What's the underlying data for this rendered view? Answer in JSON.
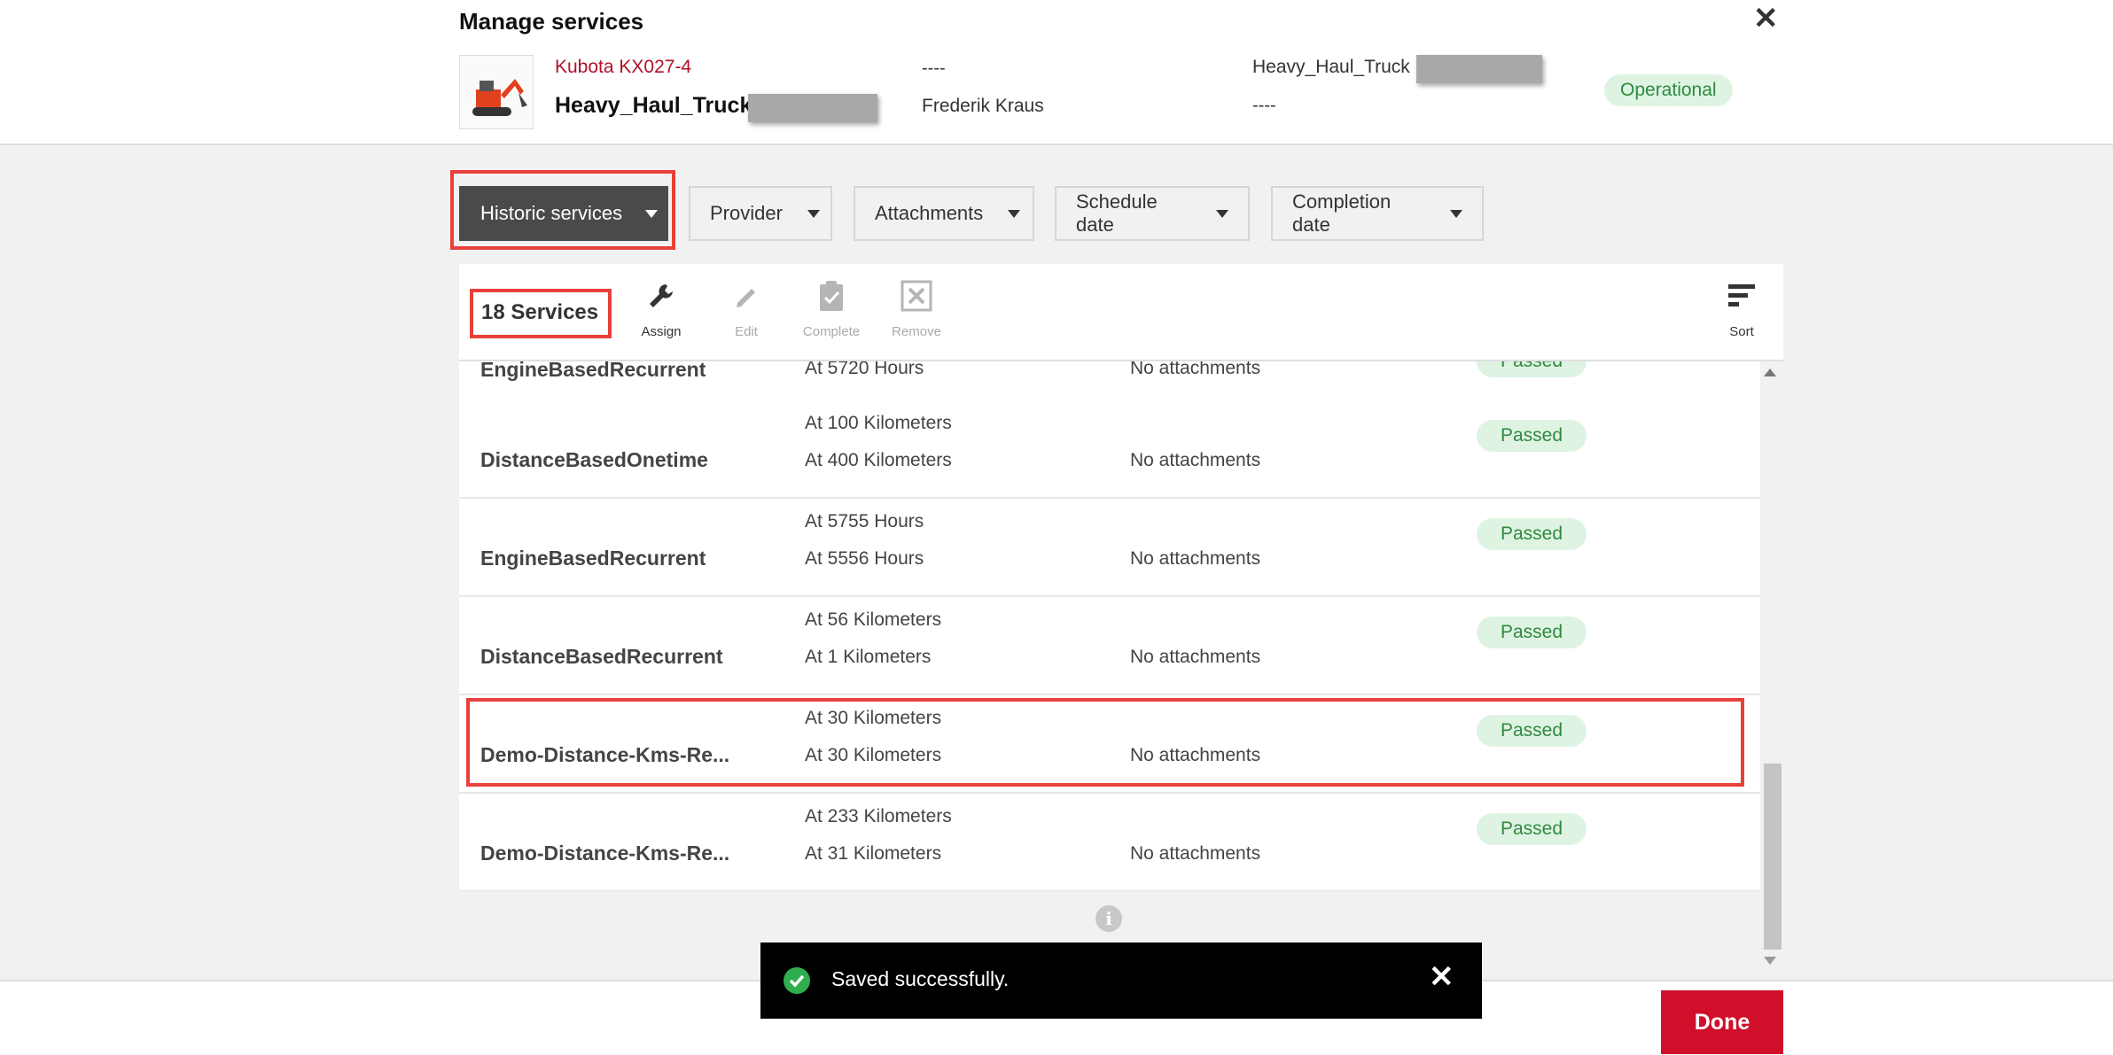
{
  "header": {
    "title": "Manage services",
    "close_icon": "close-icon",
    "asset": {
      "model": "Kubota KX027-4",
      "name": "Heavy_Haul_Truck",
      "col2_top": "----",
      "col2_bottom": "Frederik Kraus",
      "col3_top": "Heavy_Haul_Truck",
      "col3_bottom": "----",
      "status": "Operational"
    }
  },
  "filters": {
    "historic": "Historic services",
    "provider": "Provider",
    "attachments": "Attachments",
    "schedule_date": "Schedule date",
    "completion_date": "Completion date"
  },
  "toolbar": {
    "count": "18 Services",
    "assign": "Assign",
    "edit": "Edit",
    "complete": "Complete",
    "remove": "Remove",
    "sort": "Sort"
  },
  "rows": [
    {
      "name": "EngineBasedRecurrent",
      "v1": "",
      "v2": "At 5720 Hours",
      "attachments": "No attachments",
      "status": "Passed"
    },
    {
      "name": "DistanceBasedOnetime",
      "v1": "At 100 Kilometers",
      "v2": "At 400 Kilometers",
      "attachments": "No attachments",
      "status": "Passed"
    },
    {
      "name": "EngineBasedRecurrent",
      "v1": "At 5755 Hours",
      "v2": "At 5556 Hours",
      "attachments": "No attachments",
      "status": "Passed"
    },
    {
      "name": "DistanceBasedRecurrent",
      "v1": "At 56 Kilometers",
      "v2": "At 1 Kilometers",
      "attachments": "No attachments",
      "status": "Passed"
    },
    {
      "name": "Demo-Distance-Kms-Re...",
      "v1": "At 30 Kilometers",
      "v2": "At 30 Kilometers",
      "attachments": "No attachments",
      "status": "Passed"
    },
    {
      "name": "Demo-Distance-Kms-Re...",
      "v1": "At 233 Kilometers",
      "v2": "At 31 Kilometers",
      "attachments": "No attachments",
      "status": "Passed"
    }
  ],
  "toast": {
    "message": "Saved successfully."
  },
  "footer": {
    "done": "Done"
  },
  "colors": {
    "brand_red": "#d0102b",
    "highlight": "#e8403a",
    "pill_bg": "#dff3e2",
    "pill_text": "#2e8a3f",
    "dark_filter": "#4a4a4c"
  }
}
